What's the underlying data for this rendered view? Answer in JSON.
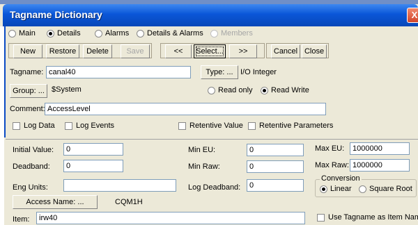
{
  "window": {
    "title": "Tagname Dictionary",
    "close_glyph": "X"
  },
  "view_options": {
    "main": "Main",
    "details": "Details",
    "alarms": "Alarms",
    "details_alarms": "Details & Alarms",
    "members": "Members",
    "selected": "Details"
  },
  "toolbar": {
    "new": "New",
    "restore": "Restore",
    "delete": "Delete",
    "save": "Save",
    "prev": "<<",
    "select": "Select...",
    "next": ">>",
    "cancel": "Cancel",
    "close": "Close"
  },
  "tag": {
    "tagname_label": "Tagname:",
    "tagname_value": "canal40",
    "type_button": "Type: ...",
    "type_value": "I/O Integer",
    "group_button": "Group: ...",
    "group_value": "$System",
    "read_only": "Read only",
    "read_write": "Read Write",
    "access_selected": "Read Write",
    "comment_label": "Comment:",
    "comment_value": "AccessLevel",
    "log_data": "Log Data",
    "log_events": "Log Events",
    "retentive_value": "Retentive Value",
    "retentive_parameters": "Retentive Parameters"
  },
  "details": {
    "initial_value_label": "Initial Value:",
    "initial_value": "0",
    "deadband_label": "Deadband:",
    "deadband": "0",
    "eng_units_label": "Eng Units:",
    "eng_units": "",
    "min_eu_label": "Min EU:",
    "min_eu": "0",
    "min_raw_label": "Min Raw:",
    "min_raw": "0",
    "log_deadband_label": "Log Deadband:",
    "log_deadband": "0",
    "max_eu_label": "Max EU:",
    "max_eu": "1000000",
    "max_raw_label": "Max Raw:",
    "max_raw": "1000000",
    "conversion_title": "Conversion",
    "linear": "Linear",
    "square_root": "Square Root",
    "conversion_selected": "Linear",
    "access_name_button": "Access Name: ...",
    "access_name_value": "CQM1H",
    "item_label": "Item:",
    "item_value": "irw40",
    "use_tagname": "Use Tagname as Item Nam"
  }
}
